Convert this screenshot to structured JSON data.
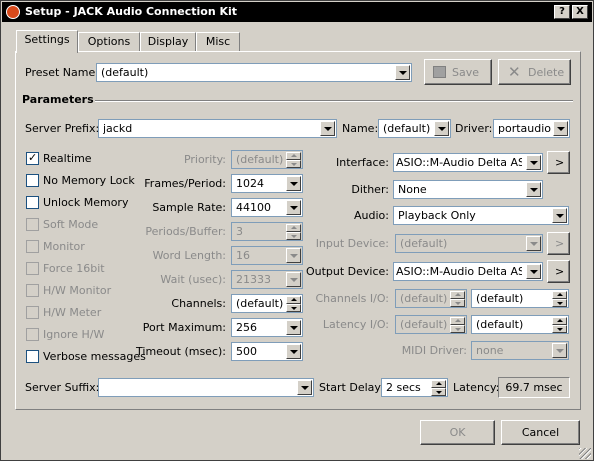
{
  "window": {
    "title": "Setup - JACK Audio Connection Kit",
    "help_button": "?",
    "close_button": "X"
  },
  "tabs": [
    {
      "label": "Settings"
    },
    {
      "label": "Options"
    },
    {
      "label": "Display"
    },
    {
      "label": "Misc"
    }
  ],
  "preset": {
    "label": "Preset Name:",
    "value": "(default)",
    "save_label": "Save",
    "delete_label": "Delete"
  },
  "parameters": {
    "heading": "Parameters",
    "server_prefix_label": "Server Prefix:",
    "server_prefix_value": "jackd",
    "name_label": "Name:",
    "name_value": "(default)",
    "driver_label": "Driver:",
    "driver_value": "portaudio"
  },
  "checkboxes": [
    {
      "label": "Realtime",
      "checked": true,
      "enabled": true
    },
    {
      "label": "No Memory Lock",
      "checked": false,
      "enabled": true
    },
    {
      "label": "Unlock Memory",
      "checked": false,
      "enabled": true
    },
    {
      "label": "Soft Mode",
      "checked": false,
      "enabled": false
    },
    {
      "label": "Monitor",
      "checked": false,
      "enabled": false
    },
    {
      "label": "Force 16bit",
      "checked": false,
      "enabled": false
    },
    {
      "label": "H/W Monitor",
      "checked": false,
      "enabled": false
    },
    {
      "label": "H/W Meter",
      "checked": false,
      "enabled": false
    },
    {
      "label": "Ignore H/W",
      "checked": false,
      "enabled": false
    },
    {
      "label": "Verbose messages",
      "checked": false,
      "enabled": true
    }
  ],
  "middle": {
    "priority_label": "Priority:",
    "priority_value": "(default)",
    "frames_label": "Frames/Period:",
    "frames_value": "1024",
    "sample_rate_label": "Sample Rate:",
    "sample_rate_value": "44100",
    "periods_label": "Periods/Buffer:",
    "periods_value": "3",
    "word_length_label": "Word Length:",
    "word_length_value": "16",
    "wait_label": "Wait (usec):",
    "wait_value": "21333",
    "channels_label": "Channels:",
    "channels_value": "(default)",
    "port_max_label": "Port Maximum:",
    "port_max_value": "256",
    "timeout_label": "Timeout (msec):",
    "timeout_value": "500"
  },
  "right": {
    "interface_label": "Interface:",
    "interface_value": "ASIO::M-Audio Delta ASIO",
    "dither_label": "Dither:",
    "dither_value": "None",
    "audio_label": "Audio:",
    "audio_value": "Playback Only",
    "input_device_label": "Input Device:",
    "input_device_value": "(default)",
    "output_device_label": "Output Device:",
    "output_device_value": "ASIO::M-Audio Delta ASIO",
    "channels_io_label": "Channels I/O:",
    "channels_io_in": "(default)",
    "channels_io_out": "(default)",
    "latency_io_label": "Latency I/O:",
    "latency_io_in": "(default)",
    "latency_io_out": "(default)",
    "midi_driver_label": "MIDI Driver:",
    "midi_driver_value": "none",
    "browse_glyph": ">"
  },
  "bottom": {
    "server_suffix_label": "Server Suffix:",
    "server_suffix_value": "",
    "start_delay_label": "Start Delay:",
    "start_delay_value": "2 secs",
    "latency_label": "Latency:",
    "latency_value": "69.7 msec"
  },
  "dialog": {
    "ok_label": "OK",
    "cancel_label": "Cancel"
  },
  "colors": {
    "titlebar": "#000000",
    "dialog_face": "#d4d0c8",
    "disabled_text": "#8a8a8a",
    "field_border": "#7f9db9"
  }
}
